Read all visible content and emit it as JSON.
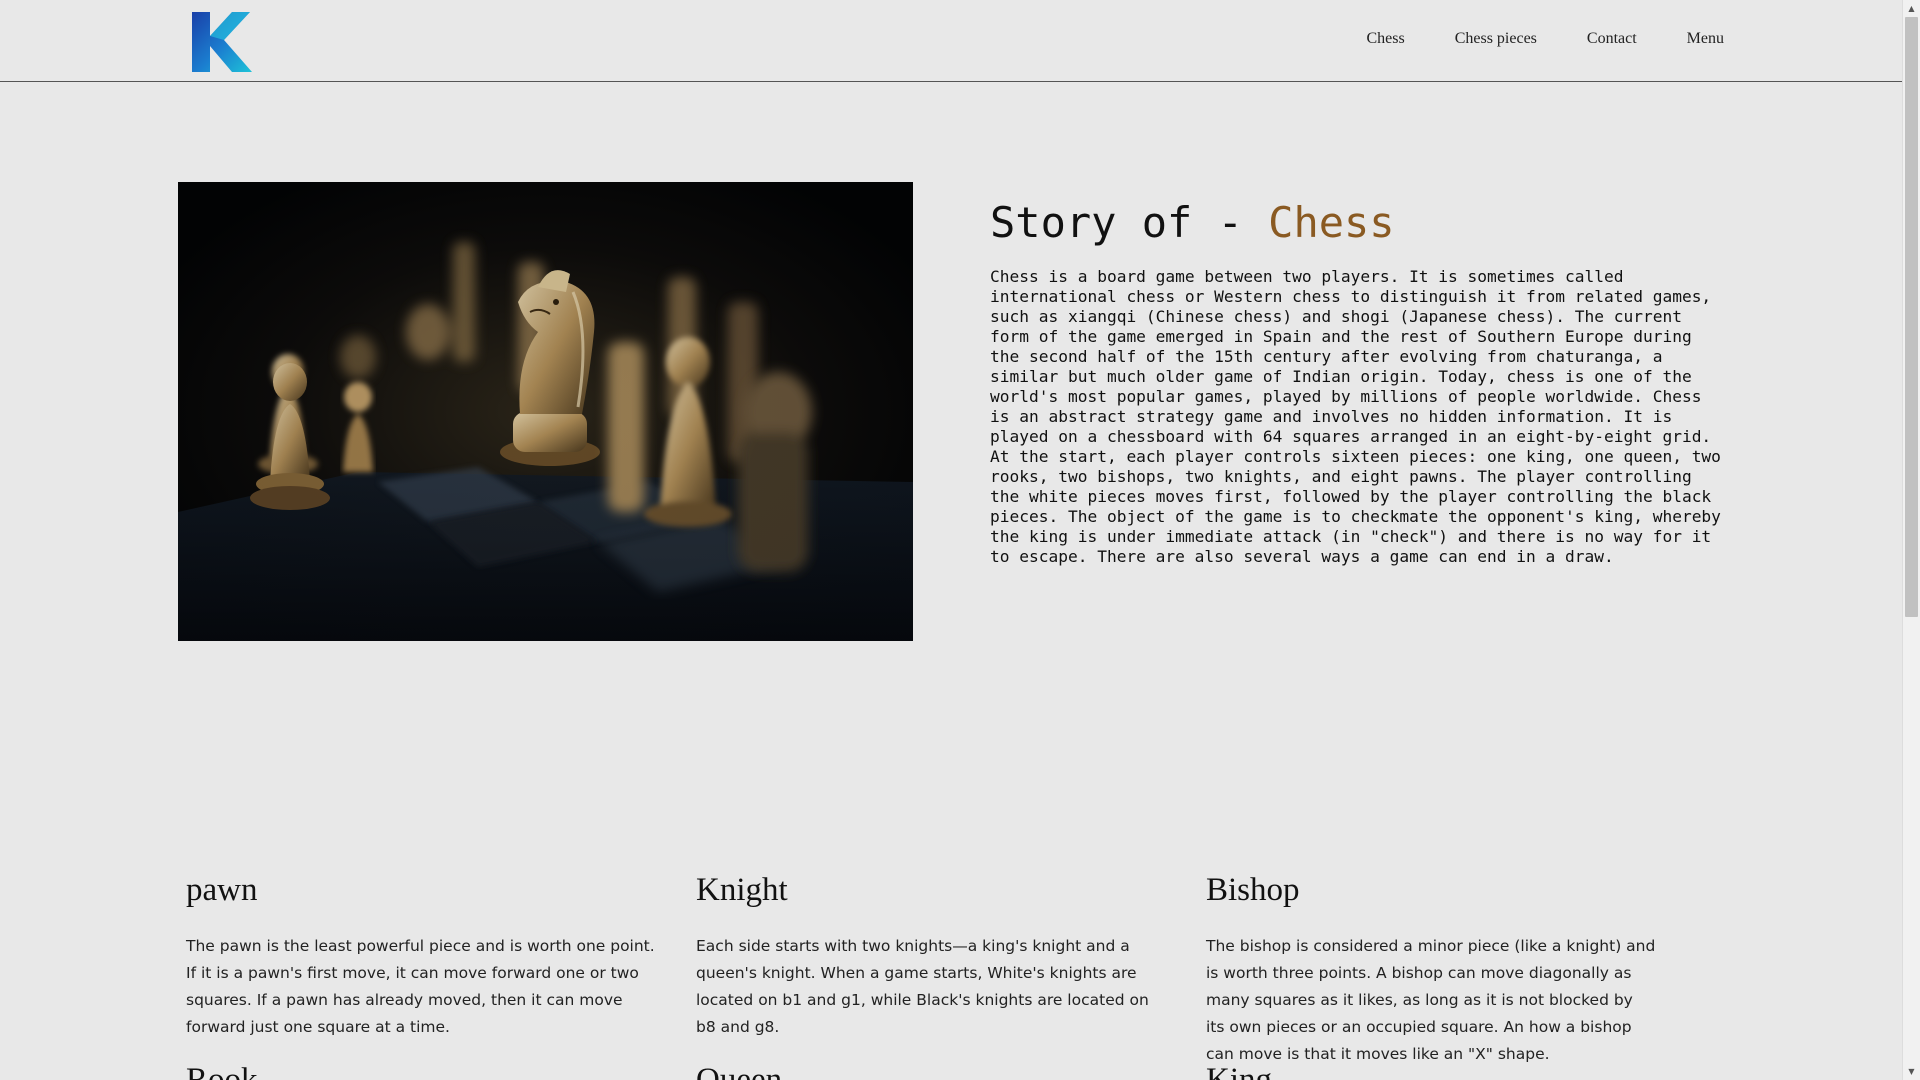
{
  "nav": {
    "items": [
      "Chess",
      "Chess pieces",
      "Contact",
      "Menu"
    ]
  },
  "logo": {
    "letter": "K",
    "colors": [
      "#1a3fa8",
      "#1ec3d8"
    ]
  },
  "hero": {
    "title_prefix": "Story of - ",
    "title_accent": "Chess",
    "accent_color": "#8a5a22",
    "body": "Chess is a board game between two players. It is sometimes called international chess or Western chess to distinguish it from related games, such as xiangqi (Chinese chess) and shogi (Japanese chess). The current form of the game emerged in Spain and the rest of Southern Europe during the second half of the 15th century after evolving from chaturanga, a similar but much older game of Indian origin. Today, chess is one of the world's most popular games, played by millions of people worldwide. Chess is an abstract strategy game and involves no hidden information. It is played on a chessboard with 64 squares arranged in an eight-by-eight grid. At the start, each player controls sixteen pieces: one king, one queen, two rooks, two bishops, two knights, and eight pawns. The player controlling the white pieces moves first, followed by the player controlling the black pieces. The object of the game is to checkmate the opponent's king, whereby the king is under immediate attack (in \"check\") and there is no way for it to escape. There are also several ways a game can end in a draw."
  },
  "pieces": [
    {
      "name": "pawn",
      "text": "The pawn is the least powerful piece and is worth one point. If it is a pawn's first move, it can move forward one or two squares. If a pawn has already moved, then it can move forward just one square at a time."
    },
    {
      "name": "Knight",
      "text": "Each side starts with two knights—a king's knight and a queen's knight. When a game starts, White's knights are located on b1 and g1, while Black's knights are located on b8 and g8."
    },
    {
      "name": "Bishop",
      "text": "The bishop is considered a minor piece (like a knight) and is worth three points. A bishop can move diagonally as many squares as it likes, as long as it is not blocked by its own pieces or an occupied square. An how a bishop can move is that it moves like an \"X\" shape."
    }
  ],
  "pieces_next_row": [
    "Rook",
    "Queen",
    "King"
  ]
}
